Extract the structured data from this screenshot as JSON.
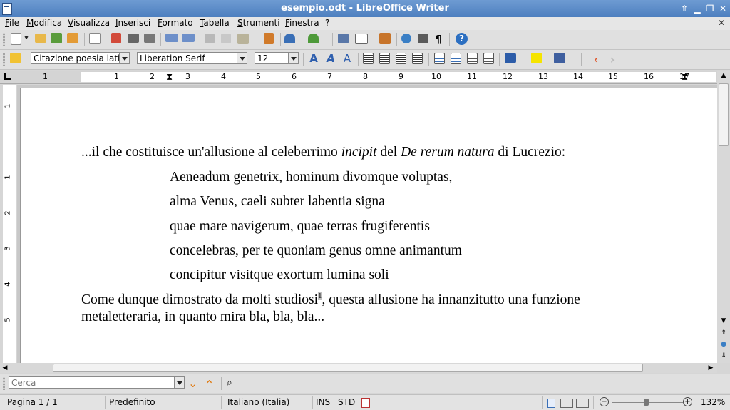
{
  "window": {
    "title": "esempio.odt - LibreOffice Writer"
  },
  "menu": [
    "File",
    "Modifica",
    "Visualizza",
    "Inserisci",
    "Formato",
    "Tabella",
    "Strumenti",
    "Finestra",
    "?"
  ],
  "format_toolbar": {
    "paragraph_style": "Citazione poesia latin",
    "font_name": "Liberation Serif",
    "font_size": "12"
  },
  "ruler": {
    "h_numbers": [
      "1",
      "1",
      "2",
      "3",
      "4",
      "5",
      "6",
      "7",
      "8",
      "9",
      "10",
      "11",
      "12",
      "13",
      "14",
      "15",
      "16",
      "17"
    ],
    "v_numbers": [
      "1",
      "1",
      "2",
      "3",
      "4",
      "5"
    ]
  },
  "document": {
    "intro": {
      "before": "...il che costituisce un'allusione al celeberrimo ",
      "incipit": "incipit",
      "middle": " del ",
      "work": "De rerum natura",
      "after": " di Lucrezio:"
    },
    "verses": [
      "Aeneadum genetrix, hominum divomque voluptas,",
      "alma Venus, caeli subter labentia signa",
      "quae mare navigerum, quae terras frugiferentis",
      "concelebras, per te quoniam genus omne animantum",
      "concipitur visitque exortum lumina soli"
    ],
    "para2_line1_a": "Come dunque dimostrato da molti studiosi",
    "footnote_ref": "1",
    "para2_line1_b": ", questa allusione ha innanzitutto una funzione",
    "para2_line2": "metaletteraria, in quanto mira bla, bla, bla..."
  },
  "findbar": {
    "placeholder": "Cerca"
  },
  "statusbar": {
    "page": "Pagina 1 / 1",
    "style": "Predefinito",
    "language": "Italiano (Italia)",
    "insert_mode": "INS",
    "selection_mode": "STD",
    "zoom": "132%"
  }
}
